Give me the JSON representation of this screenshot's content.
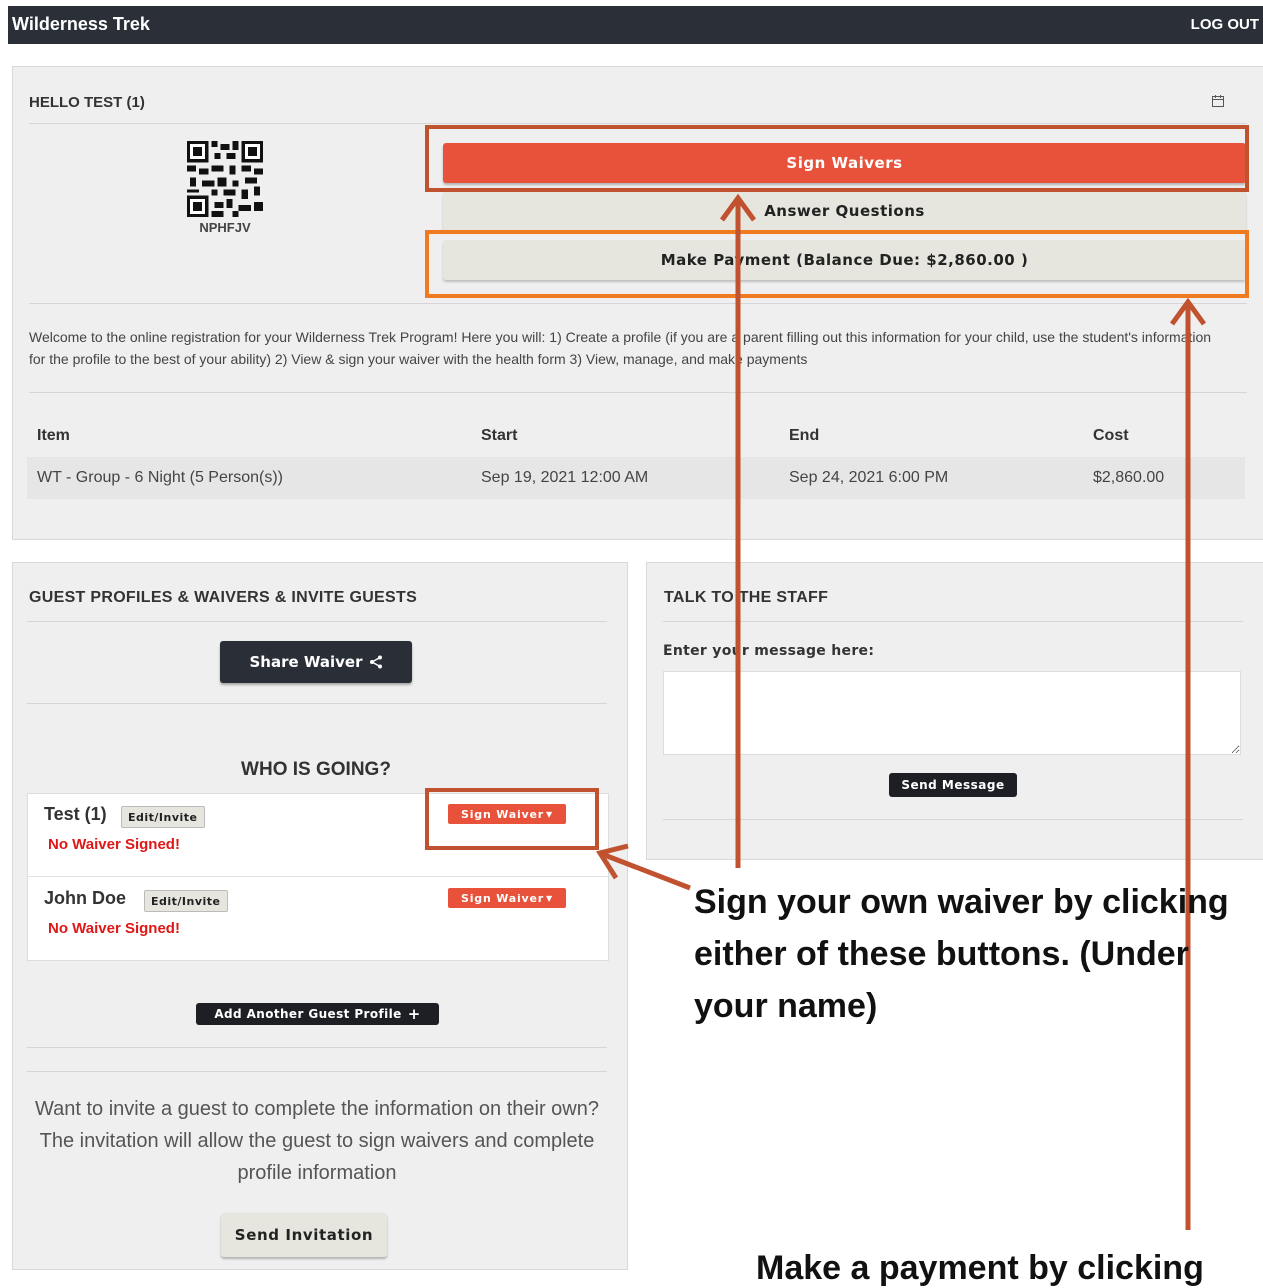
{
  "header": {
    "brand": "Wilderness Trek",
    "logout_label": "LOG OUT"
  },
  "welcome_panel": {
    "greeting": "HELLO TEST (1)",
    "calendar_icon": "calendar-icon",
    "qr_code_label": "NPHFJV",
    "buttons": {
      "sign_waivers": "Sign Waivers",
      "answer_questions": "Answer Questions",
      "make_payment": "Make Payment (Balance Due: $2,860.00 )"
    },
    "welcome_text": "Welcome to the online registration for your Wilderness Trek Program! Here you will: 1) Create a profile (if you are a parent filling out this information for your child, use the student's information for the profile to the best of your ability) 2) View & sign your waiver with the health form 3) View, manage, and make payments",
    "table": {
      "headers": [
        "Item",
        "Start",
        "End",
        "Cost"
      ],
      "rows": [
        [
          "WT - Group - 6 Night (5 Person(s))",
          "Sep 19, 2021 12:00 AM",
          "Sep 24, 2021 6:00 PM",
          "$2,860.00"
        ]
      ]
    }
  },
  "guests_panel": {
    "title": "GUEST PROFILES & WAIVERS & INVITE GUESTS",
    "share_waiver_label": "Share Waiver",
    "who_is_going": "WHO IS GOING?",
    "guests": [
      {
        "name": "Test (1)",
        "edit_label": "Edit/Invite",
        "status": "No Waiver Signed!",
        "sign_label": "Sign Waiver"
      },
      {
        "name": "John Doe",
        "edit_label": "Edit/Invite",
        "status": "No Waiver Signed!",
        "sign_label": "Sign Waiver"
      }
    ],
    "add_guest_label": "Add Another Guest Profile",
    "invite_text": "Want to invite a guest to complete the information on their own? The invitation will allow the guest to sign waivers and complete profile information",
    "send_invitation_label": "Send Invitation"
  },
  "staff_panel": {
    "title": "TALK TO THE STAFF",
    "message_label": "Enter your message here:",
    "send_message_label": "Send Message"
  },
  "annotations": {
    "callout_sign": "Sign your own waiver by clicking either of these buttons. (Under your name)",
    "callout_payment": "Make a payment by clicking",
    "highlight_color": "#c0522f",
    "highlight_orange": "#f07a20"
  }
}
